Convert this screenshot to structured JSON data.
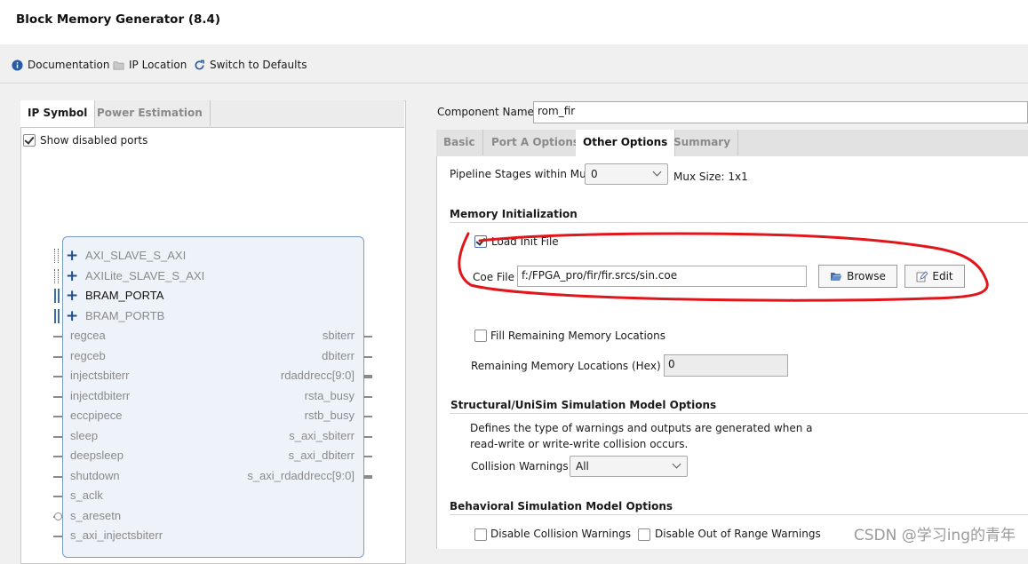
{
  "window": {
    "title": "Block Memory Generator (8.4)"
  },
  "toolbar": {
    "documentation": "Documentation",
    "ip_location": "IP Location",
    "switch_defaults": "Switch to Defaults"
  },
  "left": {
    "tabs": [
      "IP Symbol",
      "Power Estimation"
    ],
    "show_disabled_ports": "Show disabled ports",
    "bus_ports": [
      "AXI_SLAVE_S_AXI",
      "AXILite_SLAVE_S_AXI",
      "BRAM_PORTA",
      "BRAM_PORTB"
    ],
    "left_ports": [
      "regcea",
      "regceb",
      "injectsbiterr",
      "injectdbiterr",
      "eccpipece",
      "sleep",
      "deepsleep",
      "shutdown",
      "s_aclk",
      "s_aresetn",
      "s_axi_injectsbiterr"
    ],
    "right_ports": [
      "sbiterr",
      "dbiterr",
      "rdaddrecc[9:0]",
      "rsta_busy",
      "rstb_busy",
      "s_axi_sbiterr",
      "s_axi_dbiterr",
      "s_axi_rdaddrecc[9:0]"
    ]
  },
  "right": {
    "component_name_label": "Component Name",
    "component_name_value": "rom_fir",
    "tabs": [
      "Basic",
      "Port A Options",
      "Other Options",
      "Summary"
    ],
    "pipeline_label": "Pipeline Stages within Mux",
    "pipeline_value": "0",
    "mux_size": "Mux Size: 1x1",
    "mem_init_section": "Memory Initialization",
    "load_init_file": "Load Init File",
    "coe_file_label": "Coe File",
    "coe_file_value": "f:/FPGA_pro/fir/fir.srcs/sin.coe",
    "browse": "Browse",
    "edit": "Edit",
    "fill_remaining": "Fill Remaining Memory Locations",
    "remaining_label": "Remaining Memory Locations (Hex)",
    "remaining_value": "0",
    "struct_section": "Structural/UniSim Simulation Model Options",
    "struct_desc_1": "Defines the type of warnings and outputs are generated when a",
    "struct_desc_2": "read-write or write-write collision occurs.",
    "collision_label": "Collision Warnings",
    "collision_value": "All",
    "behav_section": "Behavioral Simulation Model Options",
    "disable_collision": "Disable Collision Warnings",
    "disable_oor": "Disable Out of Range Warnings"
  },
  "watermark": "CSDN @学习ing的青年",
  "colors": {
    "annotation": "#e0161b",
    "block_border": "#7a9cc4",
    "block_fill": "#eef3f9"
  }
}
